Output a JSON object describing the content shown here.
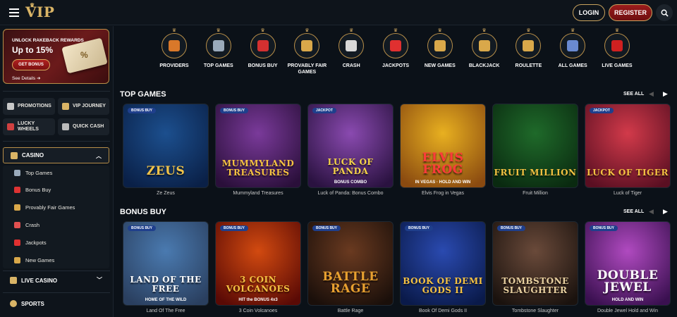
{
  "header": {
    "logo_text": "VIP",
    "login_label": "LOGIN",
    "register_label": "REGISTER"
  },
  "promo": {
    "line1": "UNLOCK RAKEBACK REWARDS",
    "line2": "Up to 15%",
    "button": "GET BONUS",
    "details": "See Details ➔",
    "ticket_symbol": "%"
  },
  "sidebar": {
    "quick": [
      {
        "label": "PROMOTIONS",
        "icon": "gift-icon",
        "color": "#c8c8c8"
      },
      {
        "label": "VIP JOURNEY",
        "icon": "crown-icon",
        "color": "#d9b466"
      },
      {
        "label": "LUCKY WHEELS",
        "icon": "wheel-icon",
        "color": "#d04040"
      },
      {
        "label": "QUICK CASH",
        "icon": "flag-icon",
        "color": "#bbbbbb"
      }
    ],
    "casino_label": "CASINO",
    "casino_items": [
      {
        "label": "Top Games",
        "icon": "plane-icon",
        "color": "#9ab"
      },
      {
        "label": "Bonus Buy",
        "icon": "cart-icon",
        "color": "#d33"
      },
      {
        "label": "Provably Fair Games",
        "icon": "scales-icon",
        "color": "#d9a84a"
      },
      {
        "label": "Crash",
        "icon": "rocket-icon",
        "color": "#e05050"
      },
      {
        "label": "Jackpots",
        "icon": "seven-icon",
        "color": "#e03030"
      },
      {
        "label": "New Games",
        "icon": "new-icon",
        "color": "#d9a84a"
      }
    ],
    "live_casino_label": "LIVE CASINO",
    "sports_label": "SPORTS"
  },
  "categories": [
    {
      "label": "PROVIDERS",
      "icon": "book-icon",
      "color": "#d9782a"
    },
    {
      "label": "TOP GAMES",
      "icon": "plane-icon",
      "color": "#9aaabb"
    },
    {
      "label": "BONUS BUY",
      "icon": "cart-icon",
      "color": "#d33030"
    },
    {
      "label": "PROVABLY FAIR GAMES",
      "icon": "scales-icon",
      "color": "#d9a84a"
    },
    {
      "label": "CRASH",
      "icon": "rocket-icon",
      "color": "#d8d8d8"
    },
    {
      "label": "JACKPOTS",
      "icon": "seven-icon",
      "color": "#e03030"
    },
    {
      "label": "NEW GAMES",
      "icon": "new-icon",
      "color": "#d9a84a"
    },
    {
      "label": "BLACKJACK",
      "icon": "chip-icon",
      "color": "#d9a84a"
    },
    {
      "label": "ROULETTE",
      "icon": "roulette-icon",
      "color": "#d9a84a"
    },
    {
      "label": "ALL GAMES",
      "icon": "slot-icon",
      "color": "#6a8ad0"
    },
    {
      "label": "LIVE GAMES",
      "icon": "bowtie-icon",
      "color": "#d02020"
    }
  ],
  "sections": [
    {
      "title": "TOP GAMES",
      "see_all": "SEE ALL",
      "games": [
        {
          "name": "Ze Zeus",
          "badge": "BONUS BUY",
          "art": "ZEUS",
          "art_sub": "",
          "bg": "#1c4f8e",
          "bg2": "#0a2047",
          "art_color": "#f0c34a"
        },
        {
          "name": "Mummyland Treasures",
          "badge": "BONUS BUY",
          "art": "MUMMYLAND TREASURES",
          "art_sub": "",
          "bg": "#7a3a9a",
          "bg2": "#2a0f3a",
          "art_color": "#f5c242"
        },
        {
          "name": "Luck of Panda: Bonus Combo",
          "badge": "JACKPOT",
          "art": "LUCK OF PANDA",
          "art_sub": "BONUS COMBO",
          "bg": "#8a4ab0",
          "bg2": "#2a1240",
          "art_color": "#f5d34a"
        },
        {
          "name": "Elvis Frog in Vegas",
          "badge": "",
          "art": "ELVIS FROG",
          "art_sub": "IN VEGAS · HOLD AND WIN",
          "bg": "#e8b020",
          "bg2": "#8a4a10",
          "art_color": "#ff3b3b"
        },
        {
          "name": "Fruit Million",
          "badge": "",
          "art": "FRUIT MILLION",
          "art_sub": "",
          "bg": "#1f6a2a",
          "bg2": "#0a2a10",
          "art_color": "#f5c242"
        },
        {
          "name": "Luck of Tiger",
          "badge": "JACKPOT",
          "art": "LUCK OF TIGER",
          "art_sub": "",
          "bg": "#d23a4a",
          "bg2": "#5a0f22",
          "art_color": "#f5c242"
        }
      ]
    },
    {
      "title": "BONUS BUY",
      "see_all": "SEE ALL",
      "games": [
        {
          "name": "Land Of The Free",
          "badge": "BONUS BUY",
          "art": "LAND OF THE FREE",
          "art_sub": "HOME OF THE WILD",
          "bg": "#4a7ab0",
          "bg2": "#2a3f5f",
          "art_color": "#ffffff"
        },
        {
          "name": "3 Coin Volcanoes",
          "badge": "BONUS BUY",
          "art": "3 COIN VOLCANOES",
          "art_sub": "HIT the BONUS 4x3",
          "bg": "#d24a10",
          "bg2": "#5a0a05",
          "art_color": "#f5c242"
        },
        {
          "name": "Battle Rage",
          "badge": "BONUS BUY",
          "art": "BATTLE RAGE",
          "art_sub": "",
          "bg": "#6a3a20",
          "bg2": "#1a0f0a",
          "art_color": "#e8a030"
        },
        {
          "name": "Book Of Demi Gods II",
          "badge": "BONUS BUY",
          "art": "BOOK OF DEMI GODS II",
          "art_sub": "",
          "bg": "#2a4ab0",
          "bg2": "#0a1a4a",
          "art_color": "#f5c242"
        },
        {
          "name": "Tombstone Slaughter",
          "badge": "BONUS BUY",
          "art": "TOMBSTONE SLAUGHTER",
          "art_sub": "",
          "bg": "#6a4a3a",
          "bg2": "#1a120e",
          "art_color": "#e8d0a0"
        },
        {
          "name": "Double Jewel Hold and Win",
          "badge": "BONUS BUY",
          "art": "DOUBLE JEWEL",
          "art_sub": "HOLD AND WIN",
          "bg": "#b04ac0",
          "bg2": "#3a1050",
          "art_color": "#ffffff"
        }
      ]
    }
  ]
}
